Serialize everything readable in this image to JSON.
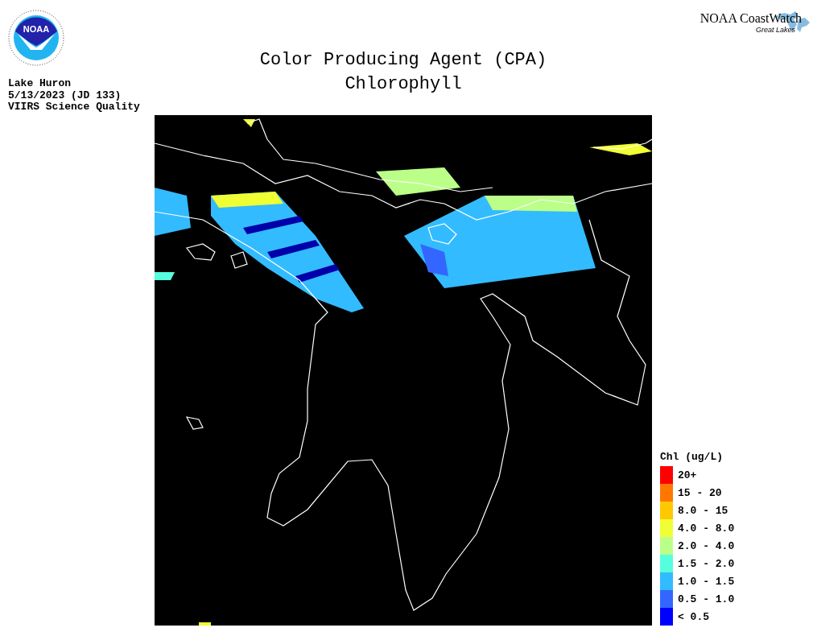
{
  "header": {
    "logo_text": "NOAA",
    "brand": "NOAA CoastWatch",
    "brand_sub": "Great Lakes",
    "title_lines": [
      "Color Producing Agent (CPA)",
      "Chlorophyll"
    ],
    "info_lines": [
      "Lake Huron",
      "5/13/2023 (JD 133)",
      "VIIRS Science Quality"
    ]
  },
  "legend": {
    "title": "Chl (ug/L)",
    "items": [
      {
        "label": "20+",
        "color": "#ff0000"
      },
      {
        "label": "15 - 20",
        "color": "#ff7700"
      },
      {
        "label": "8.0 - 15",
        "color": "#ffc800"
      },
      {
        "label": "4.0 - 8.0",
        "color": "#f0ff33"
      },
      {
        "label": "2.0 - 4.0",
        "color": "#bbff88"
      },
      {
        "label": "1.5 - 2.0",
        "color": "#55ffdd"
      },
      {
        "label": "1.0 - 1.5",
        "color": "#33bbff"
      },
      {
        "label": "0.5 - 1.0",
        "color": "#3366ff"
      },
      {
        "label": "< 0.5",
        "color": "#0000ff"
      }
    ]
  }
}
